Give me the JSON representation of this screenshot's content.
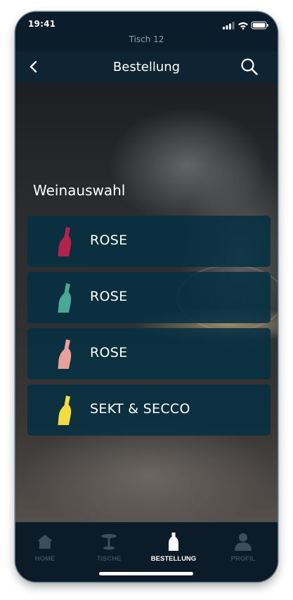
{
  "status": {
    "time": "19:41"
  },
  "header": {
    "table": "Tisch 12",
    "title": "Bestellung"
  },
  "section": {
    "title": "Weinauswahl"
  },
  "categories": [
    {
      "label": "ROSE",
      "icon": "wine-bottle-icon",
      "color": "#b3224a"
    },
    {
      "label": "ROSE",
      "icon": "wine-bottle-icon",
      "color": "#4aa896"
    },
    {
      "label": "ROSE",
      "icon": "wine-bottle-icon",
      "color": "#e9a09b"
    },
    {
      "label": "SEKT & SECCO",
      "icon": "champagne-bottle-icon",
      "color": "#f1dd3f"
    }
  ],
  "tabs": [
    {
      "label": "HOME",
      "icon": "home-icon",
      "active": false
    },
    {
      "label": "TISCHE",
      "icon": "table-icon",
      "active": false
    },
    {
      "label": "BESTELLUNG",
      "icon": "bottle-icon",
      "active": true
    },
    {
      "label": "PROFIL",
      "icon": "profile-icon",
      "active": false
    }
  ],
  "colors": {
    "navbar": "#0e2433",
    "card": "#053042",
    "tab_inactive": "#3b4e5a",
    "tab_active": "#ffffff"
  }
}
